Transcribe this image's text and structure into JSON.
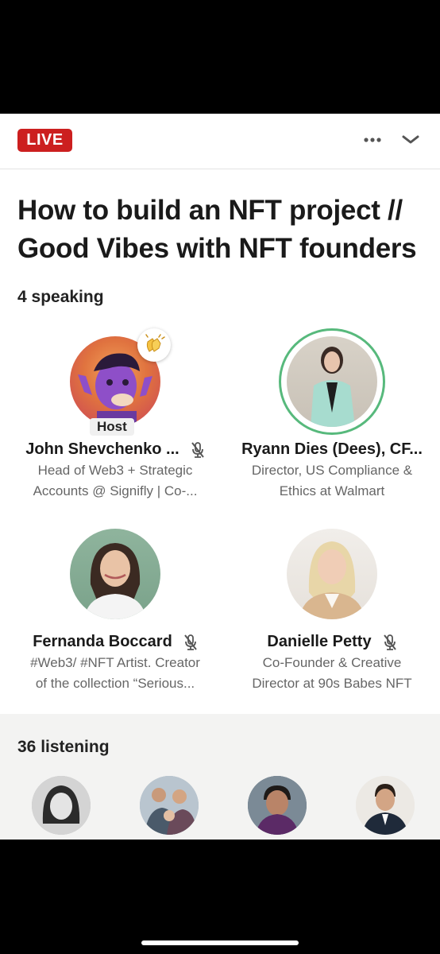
{
  "header": {
    "live_label": "LIVE",
    "more_icon": "more-horizontal-icon",
    "collapse_icon": "chevron-down-icon",
    "live_color": "#cc1f1f"
  },
  "event": {
    "title_line1": "How to build an NFT project //",
    "title_line2": "Good Vibes with NFT founders"
  },
  "speaking": {
    "heading": "4 speaking",
    "speakers": [
      {
        "name": "John Shevchenko ...",
        "role_badge": "Host",
        "subtitle_line1": "Head of Web3 + Strategic",
        "subtitle_line2": "Accounts @ Signifly | Co-...",
        "muted": true,
        "reaction": "clapping-hands-emoji"
      },
      {
        "name": "Ryann Dies (Dees), CF...",
        "subtitle_line1": "Director, US Compliance &",
        "subtitle_line2": "Ethics at Walmart",
        "muted": false,
        "speaking_ring_color": "#57b97c"
      },
      {
        "name": "Fernanda Boccard",
        "subtitle_line1": "#Web3/ #NFT Artist. Creator",
        "subtitle_line2": "of the collection “Serious...",
        "muted": true
      },
      {
        "name": "Danielle Petty",
        "subtitle_line1": "Co-Founder & Creative",
        "subtitle_line2": "Director at 90s Babes NFT",
        "muted": true
      }
    ]
  },
  "listening": {
    "heading": "36 listening",
    "listener_count_visible": 4
  }
}
